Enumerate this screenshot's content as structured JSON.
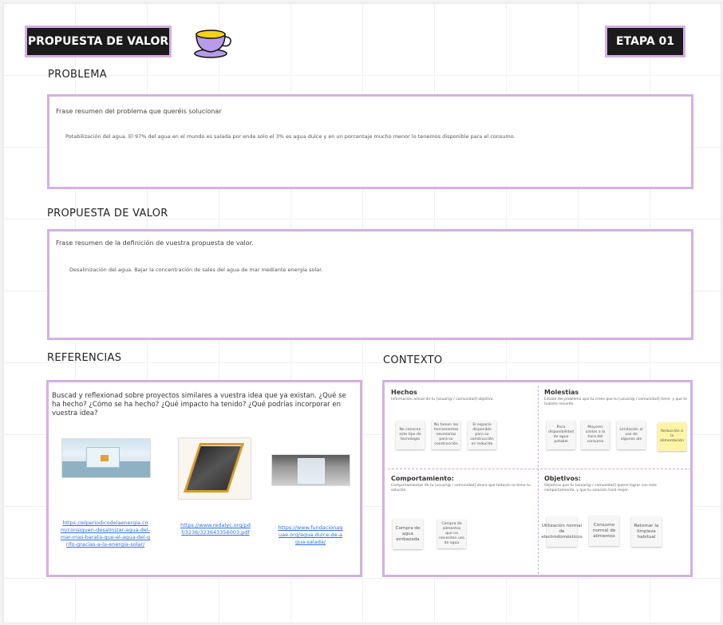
{
  "header": {
    "title": "PROPUESTA DE VALOR",
    "stage": "ETAPA 01",
    "cup_icon": "teacup-icon"
  },
  "problema": {
    "heading": "PROBLEMA",
    "lead": "Frase resumen del problema que queréis solucionar",
    "text": "Potabilización del agua. El 97% del agua en el mundo es salada por ende solo el 3% es agua dulce y en un porcentaje mucho menor lo tenemos disponible para el consumo."
  },
  "propuesta": {
    "heading": "PROPUESTA DE VALOR",
    "lead": "Frase resumen de la definición de vuestra propuesta de valor.",
    "text": "Desalinización del agua. Bajar la concentración de sales del agua de mar mediante energía solar."
  },
  "referencias": {
    "heading": "REFERENCIAS",
    "lead": "Buscad y reflexionad sobre proyectos similares a vuestra idea que ya existan. ¿Qué se ha hecho? ¿Cómo se ha hecho? ¿Qué impacto ha tenido? ¿Qué podrías incorporar en vuestra idea?",
    "links": [
      "https://elperiodicodelaenergia.com/consiguen-desalinizar-agua-del-mar-mas-barata-que-el-agua-del-grifo-gracias-a-la-energia-solar/",
      "https://www.redalyc.org/pdf/3236/323643356003.pdf",
      "https://www.fundacionaquae.org/agua-dulce-de-agua-salada/"
    ]
  },
  "contexto": {
    "heading": "CONTEXTO",
    "hechos": {
      "title": "Hechos",
      "sub": "Información actual de tu [usuari@ / comunidad] objetivo.",
      "notes": [
        "No conocen este tipo de tecnología",
        "No tienen las herramientas necesarias para su construcción",
        "El espacio disponible para su construcción es reducido"
      ]
    },
    "molestias": {
      "title": "Molestias",
      "sub": "Estado del problema que tu crees que tu [usuari@ / comunidad] tiene, y que te hubiste resuelto.",
      "notes": [
        "Poca disponibilidad de agua potable",
        "Mayores costos a la hora del consumo",
        "Limitación al uso de algunos ale",
        "Reducción a la alimentación"
      ]
    },
    "comportamiento": {
      "title": "Comportamiento:",
      "sub": "Comportamientos de tu [usuari@ / comunidad] ahora que todavía no tiene tu solución",
      "notes": [
        "Compra de agua embazada",
        "Compra de alimentos que no necesiten uso de agua"
      ]
    },
    "objetivos": {
      "title": "Objetivos:",
      "sub": "Objetivos que tu [usuari@ / comunidad] quiere lograr con este comportamiento, y que tu solución hará mejor.",
      "notes": [
        "Utilización normal de electrodomésticos",
        "Consumo normal de alimentos",
        "Retomar la limpieza habitual"
      ]
    }
  },
  "colors": {
    "accent_border": "#d4b0e2",
    "tag_bg": "#1b1b1b",
    "link": "#2f6fe0",
    "sticky_yellow": "#fdf5a6"
  }
}
